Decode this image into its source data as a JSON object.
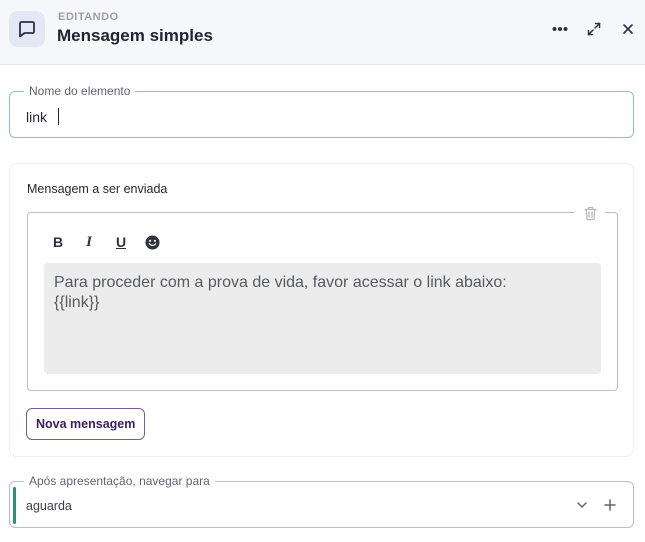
{
  "header": {
    "editing_label": "EDITANDO",
    "title": "Mensagem simples",
    "icons": [
      "chat-bubble-icon",
      "more-options-icon",
      "expand-icon",
      "close-icon"
    ]
  },
  "name_field": {
    "legend": "Nome do elemento",
    "value": "link"
  },
  "message_card": {
    "title": "Mensagem a ser enviada",
    "toolbar": {
      "bold": "B",
      "italic": "I",
      "underline": "U"
    },
    "message_text_line1": "Para proceder com a prova de vida, favor acessar o link abaixo:",
    "message_text_line2": "{{link}}",
    "new_message_label": "Nova mensagem"
  },
  "navigate_field": {
    "legend": "Após apresentação, navegar para",
    "value": "aguarda"
  },
  "colors": {
    "accent_green": "#2e8f72",
    "name_field_border": "#8cc3c0",
    "button_purple": "#3a1f5e"
  }
}
